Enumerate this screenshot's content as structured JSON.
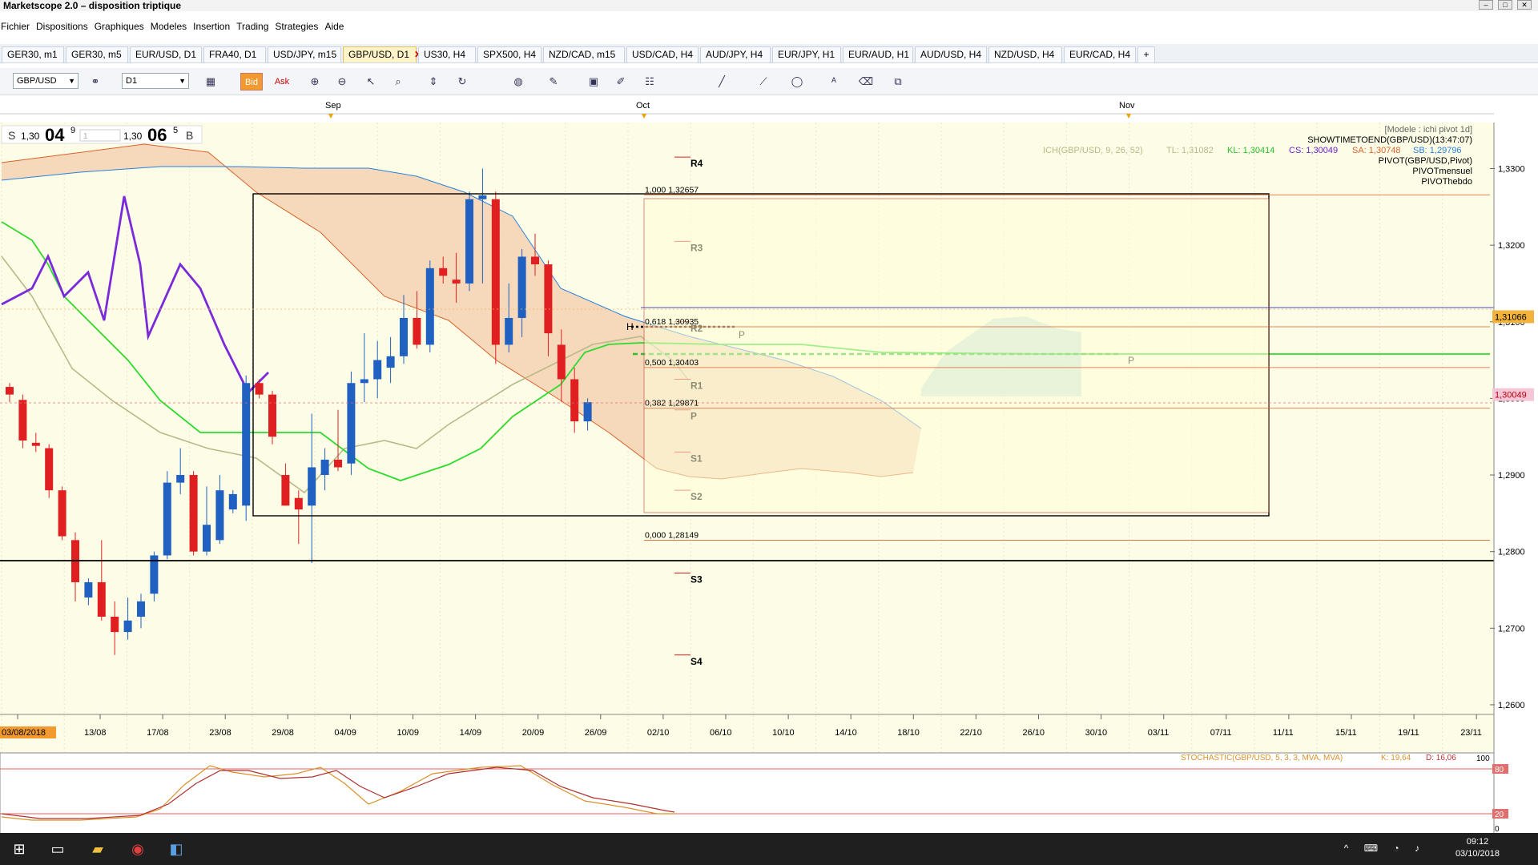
{
  "window": {
    "title": "Marketscope 2.0 – disposition triptique"
  },
  "menu": [
    "Fichier",
    "Dispositions",
    "Graphiques",
    "Modeles",
    "Insertion",
    "Trading",
    "Strategies",
    "Aide"
  ],
  "tabs": [
    {
      "label": "GER30, m1"
    },
    {
      "label": "GER30, m5"
    },
    {
      "label": "EUR/USD, D1"
    },
    {
      "label": "FRA40, D1"
    },
    {
      "label": "USD/JPY, m15"
    },
    {
      "label": "GBP/USD, D1",
      "active": true
    },
    {
      "label": "US30, H4"
    },
    {
      "label": "SPX500, H4"
    },
    {
      "label": "NZD/CAD, m15"
    },
    {
      "label": "USD/CAD, H4"
    },
    {
      "label": "AUD/JPY, H4"
    },
    {
      "label": "EUR/JPY, H1"
    },
    {
      "label": "EUR/AUD, H1"
    },
    {
      "label": "AUD/USD, H4"
    },
    {
      "label": "NZD/USD, H4"
    },
    {
      "label": "EUR/CAD, H4"
    }
  ],
  "toolbar": {
    "symbol": "GBP/USD",
    "timeframe": "D1",
    "bid_label": "Bid",
    "ask_label": "Ask"
  },
  "quote": {
    "sell_label": "S",
    "sell_prefix": "1,30",
    "sell_big": "04",
    "sell_sup": "9",
    "amount": "1",
    "buy_prefix": "1,30",
    "buy_big": "06",
    "buy_sup": "5",
    "buy_label": "B"
  },
  "info": {
    "model": "[Modele : ichi pivot 1d]",
    "showtime": "SHOWTIMETOEND(GBP/USD)(13:47:07)",
    "ich_name": "ICH(GBP/USD, 9, 26, 52)",
    "tl": "TL: 1,31082",
    "kl": "KL: 1,30414",
    "cs": "CS: 1,30049",
    "sa": "SA: 1,30748",
    "sb": "SB: 1,29796",
    "pivot": "PIVOT(GBP/USD,Pivot)",
    "pivot_m": "PIVOTmensuel",
    "pivot_h": "PIVOThebdo",
    "stoch": "STOCHASTIC(GBP/USD, 5, 3, 3, MVA, MVA)",
    "stoch_k": "K: 19,64",
    "stoch_d": "D: 16,06"
  },
  "chart_data": {
    "type": "candlestick",
    "y_axis": {
      "min": 1.2555,
      "max": 1.3335,
      "ticks": [
        "1,3300",
        "1,3200",
        "1,3100",
        "1,3000",
        "1,2900",
        "1,2800",
        "1,2700",
        "1,2600"
      ]
    },
    "x_labels": [
      "03/08/2018",
      "13/08",
      "17/08",
      "23/08",
      "29/08",
      "04/09",
      "10/09",
      "14/09",
      "20/09",
      "26/09",
      "02/10",
      "06/10",
      "10/10",
      "14/10",
      "18/10",
      "22/10",
      "26/10",
      "30/10",
      "03/11",
      "07/11",
      "11/11",
      "15/11",
      "19/11",
      "23/11"
    ],
    "month_labels": [
      "Sep",
      "Oct",
      "Nov"
    ],
    "price_labels": {
      "top": "1,31066",
      "current": "1,30049"
    },
    "fib": [
      {
        "label": "1,000 1,32657",
        "v": 1.32657
      },
      {
        "label": "0,618 1,30935",
        "v": 1.30935
      },
      {
        "label": "0,500 1,30403",
        "v": 1.30403
      },
      {
        "label": "0,382 1,29871",
        "v": 1.29871
      },
      {
        "label": "0,000 1,28149",
        "v": 1.28149
      }
    ],
    "pivots": [
      {
        "label": "R4",
        "v": 1.3315
      },
      {
        "label": "R3",
        "v": 1.3205
      },
      {
        "label": "R2",
        "v": 1.31
      },
      {
        "label": "R1",
        "v": 1.3025
      },
      {
        "label": "P",
        "v": 1.2985
      },
      {
        "label": "S1",
        "v": 1.293
      },
      {
        "label": "S2",
        "v": 1.288
      },
      {
        "label": "S3",
        "v": 1.2772
      },
      {
        "label": "S4",
        "v": 1.2665
      }
    ],
    "pivot_m_label": "P",
    "pivot_h_label": "P",
    "h_label": "H",
    "candles": [
      {
        "o": 1.3015,
        "h": 1.302,
        "l": 1.2995,
        "c": 1.3005
      },
      {
        "o": 1.2998,
        "h": 1.3005,
        "l": 1.2935,
        "c": 1.2945
      },
      {
        "o": 1.2942,
        "h": 1.2955,
        "l": 1.293,
        "c": 1.2938
      },
      {
        "o": 1.2935,
        "h": 1.294,
        "l": 1.287,
        "c": 1.288
      },
      {
        "o": 1.288,
        "h": 1.2885,
        "l": 1.2815,
        "c": 1.282
      },
      {
        "o": 1.2815,
        "h": 1.2825,
        "l": 1.2735,
        "c": 1.276
      },
      {
        "o": 1.274,
        "h": 1.2765,
        "l": 1.273,
        "c": 1.276
      },
      {
        "o": 1.276,
        "h": 1.2815,
        "l": 1.271,
        "c": 1.2715
      },
      {
        "o": 1.2715,
        "h": 1.2735,
        "l": 1.2665,
        "c": 1.2695
      },
      {
        "o": 1.2695,
        "h": 1.274,
        "l": 1.2685,
        "c": 1.271
      },
      {
        "o": 1.2715,
        "h": 1.2745,
        "l": 1.27,
        "c": 1.2735
      },
      {
        "o": 1.2745,
        "h": 1.28,
        "l": 1.2735,
        "c": 1.2795
      },
      {
        "o": 1.2795,
        "h": 1.2905,
        "l": 1.279,
        "c": 1.289
      },
      {
        "o": 1.289,
        "h": 1.2935,
        "l": 1.2875,
        "c": 1.29
      },
      {
        "o": 1.29,
        "h": 1.2905,
        "l": 1.2795,
        "c": 1.28
      },
      {
        "o": 1.28,
        "h": 1.2885,
        "l": 1.2795,
        "c": 1.2835
      },
      {
        "o": 1.2815,
        "h": 1.29,
        "l": 1.281,
        "c": 1.288
      },
      {
        "o": 1.2855,
        "h": 1.288,
        "l": 1.285,
        "c": 1.2875
      },
      {
        "o": 1.286,
        "h": 1.303,
        "l": 1.284,
        "c": 1.302
      },
      {
        "o": 1.302,
        "h": 1.3025,
        "l": 1.3,
        "c": 1.3005
      },
      {
        "o": 1.3005,
        "h": 1.301,
        "l": 1.294,
        "c": 1.295
      },
      {
        "o": 1.29,
        "h": 1.2915,
        "l": 1.286,
        "c": 1.286
      },
      {
        "o": 1.287,
        "h": 1.288,
        "l": 1.281,
        "c": 1.2855
      },
      {
        "o": 1.286,
        "h": 1.298,
        "l": 1.2785,
        "c": 1.291
      },
      {
        "o": 1.29,
        "h": 1.2935,
        "l": 1.288,
        "c": 1.292
      },
      {
        "o": 1.292,
        "h": 1.2985,
        "l": 1.2905,
        "c": 1.291
      },
      {
        "o": 1.2915,
        "h": 1.3035,
        "l": 1.29,
        "c": 1.302
      },
      {
        "o": 1.302,
        "h": 1.3085,
        "l": 1.2995,
        "c": 1.3025
      },
      {
        "o": 1.3025,
        "h": 1.3075,
        "l": 1.3,
        "c": 1.305
      },
      {
        "o": 1.304,
        "h": 1.308,
        "l": 1.302,
        "c": 1.3055
      },
      {
        "o": 1.3055,
        "h": 1.3135,
        "l": 1.3045,
        "c": 1.3105
      },
      {
        "o": 1.3105,
        "h": 1.314,
        "l": 1.3065,
        "c": 1.307
      },
      {
        "o": 1.307,
        "h": 1.318,
        "l": 1.306,
        "c": 1.317
      },
      {
        "o": 1.317,
        "h": 1.3185,
        "l": 1.315,
        "c": 1.316
      },
      {
        "o": 1.3155,
        "h": 1.319,
        "l": 1.3125,
        "c": 1.315
      },
      {
        "o": 1.315,
        "h": 1.327,
        "l": 1.314,
        "c": 1.326
      },
      {
        "o": 1.326,
        "h": 1.33,
        "l": 1.315,
        "c": 1.3265
      },
      {
        "o": 1.326,
        "h": 1.327,
        "l": 1.3045,
        "c": 1.307
      },
      {
        "o": 1.307,
        "h": 1.315,
        "l": 1.306,
        "c": 1.3105
      },
      {
        "o": 1.3105,
        "h": 1.3195,
        "l": 1.308,
        "c": 1.3185
      },
      {
        "o": 1.3185,
        "h": 1.3215,
        "l": 1.316,
        "c": 1.3175
      },
      {
        "o": 1.3175,
        "h": 1.318,
        "l": 1.3055,
        "c": 1.3085
      },
      {
        "o": 1.307,
        "h": 1.309,
        "l": 1.2995,
        "c": 1.3025
      },
      {
        "o": 1.3025,
        "h": 1.304,
        "l": 1.2955,
        "c": 1.297
      },
      {
        "o": 1.297,
        "h": 1.3,
        "l": 1.2958,
        "c": 1.2995
      }
    ]
  }
}
